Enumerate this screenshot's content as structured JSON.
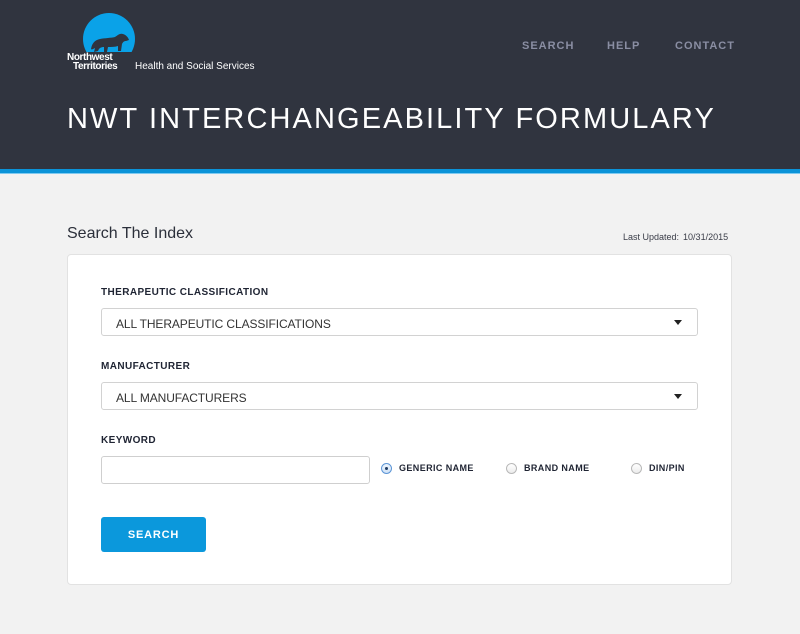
{
  "header": {
    "logo": {
      "icon": "polar-bear-icon",
      "line1": "Northwest",
      "line2": "Territories",
      "department": "Health and Social Services"
    },
    "nav": [
      {
        "label": "SEARCH"
      },
      {
        "label": "HELP"
      },
      {
        "label": "CONTACT"
      }
    ],
    "title": "NWT INTERCHANGEABILITY FORMULARY"
  },
  "colors": {
    "header_bg": "#30343f",
    "accent": "#0b93d8",
    "button": "#0b98dc",
    "page_bg": "#f2f2f2"
  },
  "search": {
    "section_title": "Search The Index",
    "last_updated_label": "Last Updated:",
    "last_updated_value": "10/31/2015",
    "therapeutic": {
      "label": "THERAPEUTIC CLASSIFICATION",
      "selected": "ALL THERAPEUTIC CLASSIFICATIONS"
    },
    "manufacturer": {
      "label": "MANUFACTURER",
      "selected": "ALL MANUFACTURERS"
    },
    "keyword": {
      "label": "KEYWORD",
      "value": "",
      "placeholder": ""
    },
    "search_type": [
      {
        "label": "GENERIC NAME",
        "checked": true
      },
      {
        "label": "BRAND NAME",
        "checked": false
      },
      {
        "label": "DIN/PIN",
        "checked": false
      }
    ],
    "button_label": "SEARCH"
  }
}
